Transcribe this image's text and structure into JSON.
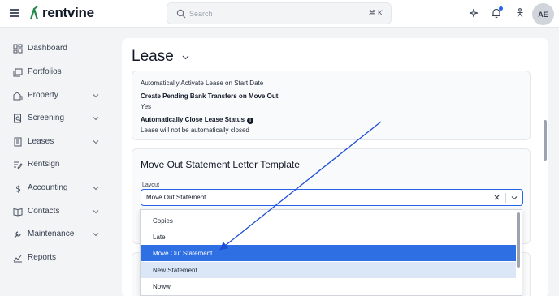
{
  "header": {
    "logo_text": "rentvine",
    "search_placeholder": "Search",
    "search_shortcut": "⌘ K",
    "avatar_initials": "AE",
    "accent_color": "#2563eb",
    "brand_color": "#1f8a4c"
  },
  "sidebar": {
    "items": [
      {
        "label": "Dashboard",
        "icon": "dashboard-icon",
        "expandable": false
      },
      {
        "label": "Portfolios",
        "icon": "portfolios-icon",
        "expandable": false
      },
      {
        "label": "Property",
        "icon": "property-icon",
        "expandable": true
      },
      {
        "label": "Screening",
        "icon": "screening-icon",
        "expandable": true
      },
      {
        "label": "Leases",
        "icon": "leases-icon",
        "expandable": true
      },
      {
        "label": "Rentsign",
        "icon": "rentsign-icon",
        "expandable": false
      },
      {
        "label": "Accounting",
        "icon": "accounting-icon",
        "expandable": true
      },
      {
        "label": "Contacts",
        "icon": "contacts-icon",
        "expandable": true
      },
      {
        "label": "Maintenance",
        "icon": "maintenance-icon",
        "expandable": true
      },
      {
        "label": "Reports",
        "icon": "reports-icon",
        "expandable": false
      }
    ]
  },
  "main": {
    "title": "Lease",
    "settings": {
      "auto_activate": "Automatically Activate Lease on Start Date",
      "pending_transfers_label": "Create Pending Bank Transfers on Move Out",
      "pending_transfers_value": "Yes",
      "auto_close_label": "Automatically Close Lease Status",
      "auto_close_value": "Lease will not be automatically closed"
    },
    "template_card": {
      "title": "Move Out Statement Letter Template",
      "layout_label": "Layout",
      "layout_value": "Move Out Statement"
    }
  },
  "dropdown": {
    "options": [
      "Copies",
      "Late",
      "Move Out Statement",
      "New Statement",
      "Noww"
    ],
    "selected": "Move Out Statement",
    "hovered": "New Statement"
  }
}
